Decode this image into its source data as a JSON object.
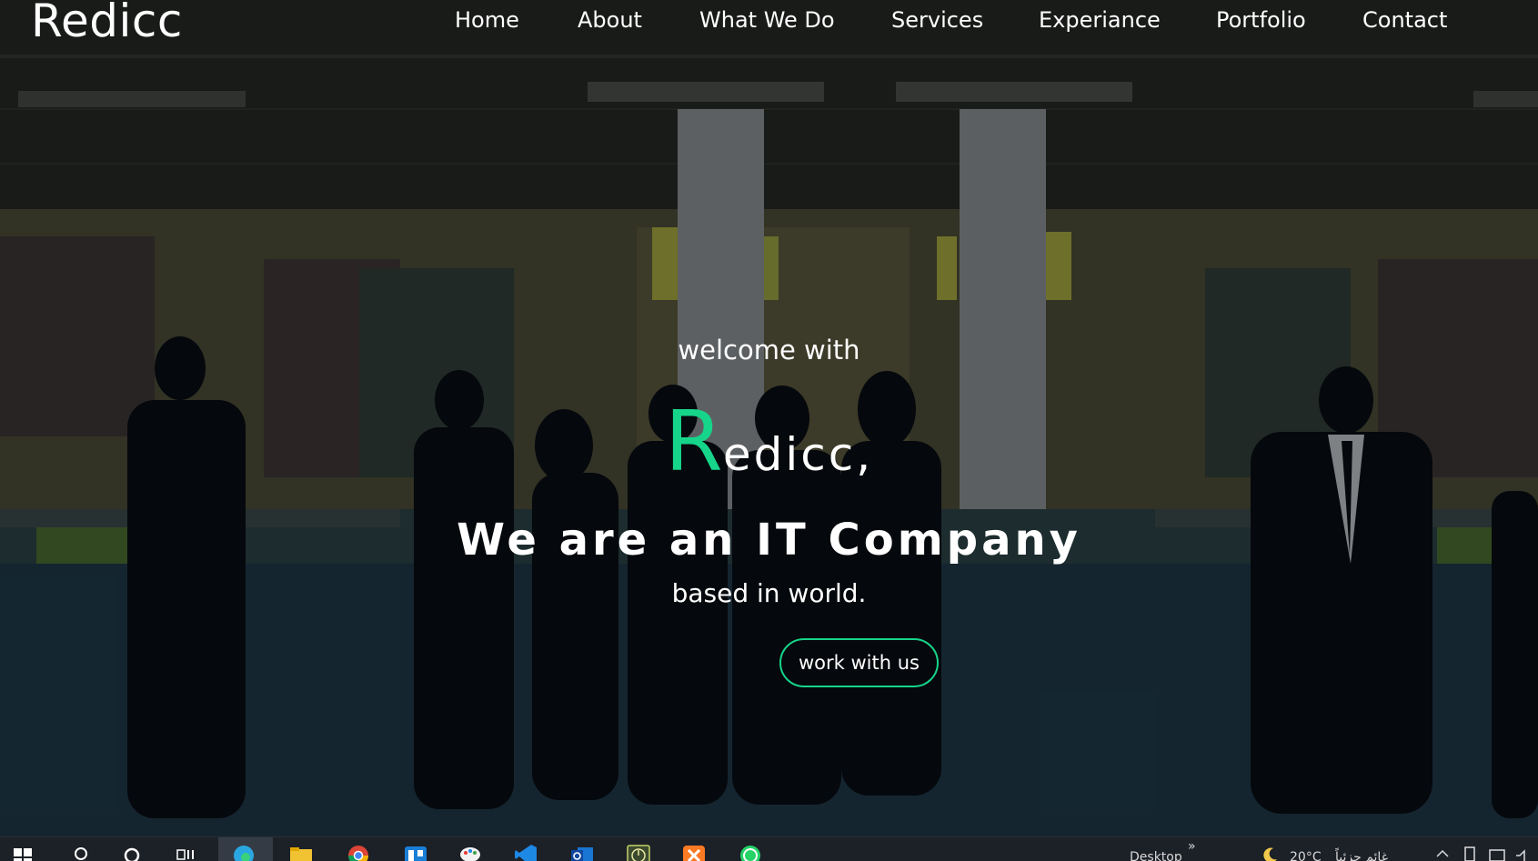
{
  "header": {
    "logo": "Redicc",
    "nav": [
      "Home",
      "About",
      "What We Do",
      "Services",
      "Experiance",
      "Portfolio",
      "Contact"
    ]
  },
  "hero": {
    "welcome": "welcome with",
    "brand_initial": "R",
    "brand_rest": "edicc,",
    "tagline": "We are an IT Company",
    "subline": "based in world.",
    "cta_label": "work with us"
  },
  "taskbar": {
    "desktop_label": "Desktop",
    "chevron": "»",
    "temperature": "20°C",
    "weather_text": "غائم جزئياً",
    "icons": [
      "windows-start-icon",
      "search-icon",
      "cortana-icon",
      "task-view-icon",
      "edge-icon",
      "file-explorer-icon",
      "chrome-icon",
      "trello-icon",
      "paint-icon",
      "vscode-icon",
      "outlook-icon",
      "clock-app-icon",
      "xampp-icon",
      "whatsapp-icon"
    ]
  },
  "colors": {
    "accent": "#16d48a",
    "text": "#ffffff",
    "taskbar": "#1c2027"
  }
}
